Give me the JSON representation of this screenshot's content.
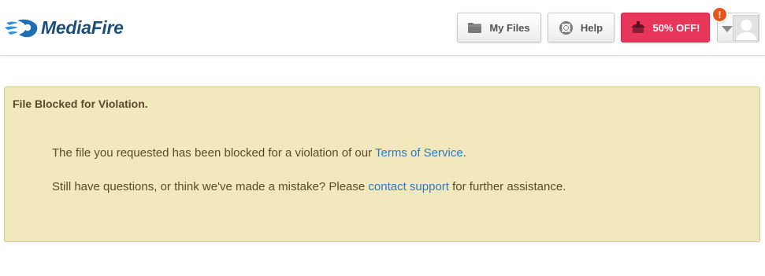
{
  "header": {
    "logo_text": "MediaFire",
    "nav": {
      "my_files_label": "My Files",
      "help_label": "Help",
      "promo_label": "50% OFF!"
    },
    "alert_badge": "!"
  },
  "notice": {
    "title": "File Blocked for Violation.",
    "line1_prefix": "The file you requested has been blocked for a violation of our ",
    "line1_link": "Terms of Service",
    "line1_suffix": ".",
    "line2_prefix": "Still have questions, or think we've made a mistake? Please ",
    "line2_link": "contact support",
    "line2_suffix": " for further assistance."
  },
  "colors": {
    "brand": "#1f4e79",
    "promo": "#e8355a",
    "notice_bg": "#f3e7bd",
    "link": "#2a7ac7",
    "badge": "#e2551c"
  },
  "icons": [
    "mediafire-logo-icon",
    "folder-icon",
    "lifebuoy-icon",
    "download-box-icon",
    "chevron-down-icon",
    "user-avatar-icon",
    "alert-icon"
  ]
}
